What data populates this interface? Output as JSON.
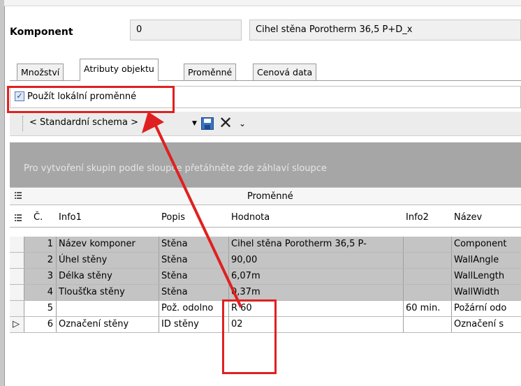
{
  "component": {
    "label": "Komponent",
    "code": "0",
    "name": "Cihel stěna Porotherm 36,5 P+D_x"
  },
  "tabs": [
    "Množství",
    "Atributy objektu",
    "Proměnné",
    "Cenová data"
  ],
  "active_tab": "Atributy objektu",
  "local_vars": {
    "checked": true,
    "label": "Použít lokální proměnné"
  },
  "toolbar": {
    "scheme_label": "< Standardní schema >"
  },
  "group_hint": "Pro vytvoření skupin podle sloupce přetáhněte zde záhlaví sloupce",
  "band_title": "Proměnné",
  "columns": [
    "Č.",
    "Info1",
    "Popis",
    "Hodnota",
    "Info2",
    "Název"
  ],
  "rows": [
    {
      "num": "1",
      "info1": "Název komponer",
      "popis": "Stěna",
      "hodnota": "Cihel stěna Porotherm 36,5 P-",
      "info2": "",
      "nazev": "Component"
    },
    {
      "num": "2",
      "info1": "Úhel stěny",
      "popis": "Stěna",
      "hodnota": "90,00",
      "info2": "",
      "nazev": "WallAngle"
    },
    {
      "num": "3",
      "info1": "Délka stěny",
      "popis": "Stěna",
      "hodnota": "6,07m",
      "info2": "",
      "nazev": "WallLength"
    },
    {
      "num": "4",
      "info1": "Tloušťka stěny",
      "popis": "Stěna",
      "hodnota": "0,37m",
      "info2": "",
      "nazev": "WallWidth"
    },
    {
      "num": "5",
      "info1": "",
      "popis": "Pož. odolno",
      "hodnota": "R 60",
      "info2": "60 min.",
      "nazev": "Požární odo"
    },
    {
      "num": "6",
      "info1": "Označení stěny",
      "popis": "ID stěny",
      "hodnota": "02",
      "info2": "",
      "nazev": "Označení s"
    }
  ],
  "colors": {
    "annotation": "#e02020",
    "shaded_row": "#c4c4c4",
    "group_panel": "#a6a6a6"
  }
}
